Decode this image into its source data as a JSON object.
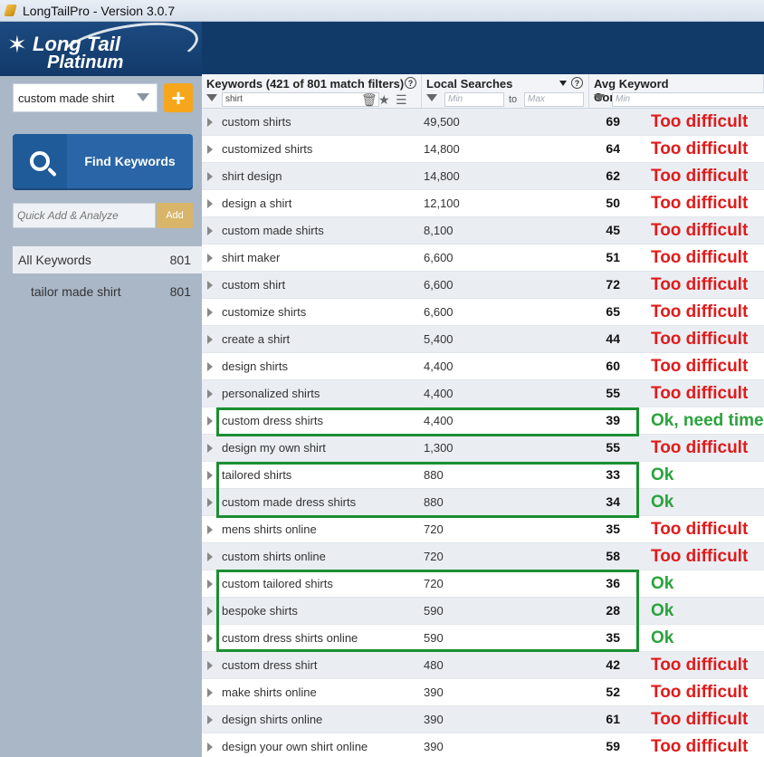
{
  "window": {
    "title": "LongTailPro - Version 3.0.7"
  },
  "brand": {
    "line1": "Long Tail",
    "line2": "Platinum"
  },
  "sidebar": {
    "seed_keyword": "custom made shirt",
    "add_label": "+",
    "find_label": "Find Keywords",
    "quick_add_placeholder": "Quick Add & Analyze",
    "quick_add_button": "Add",
    "items": [
      {
        "label": "All Keywords",
        "count": "801"
      },
      {
        "label": "tailor made shirt",
        "count": "801"
      }
    ]
  },
  "columns": {
    "keywords": {
      "title": "Keywords (421 of 801 match filters)",
      "filter_value": "shirt"
    },
    "local": {
      "title": "Local Searches",
      "min_placeholder": "Min",
      "to_label": "to",
      "max_placeholder": "Max"
    },
    "competitiveness": {
      "title": "Avg Keyword Competitiveness",
      "min_placeholder": "Min"
    }
  },
  "rows": [
    {
      "keyword": "custom shirts",
      "local": "49,500",
      "comp": "69",
      "note": "Too difficult",
      "status": "bad"
    },
    {
      "keyword": "customized shirts",
      "local": "14,800",
      "comp": "64",
      "note": "Too difficult",
      "status": "bad"
    },
    {
      "keyword": "shirt design",
      "local": "14,800",
      "comp": "62",
      "note": "Too difficult",
      "status": "bad"
    },
    {
      "keyword": "design a shirt",
      "local": "12,100",
      "comp": "50",
      "note": "Too difficult",
      "status": "bad"
    },
    {
      "keyword": "custom made shirts",
      "local": "8,100",
      "comp": "45",
      "note": "Too difficult",
      "status": "bad"
    },
    {
      "keyword": "shirt maker",
      "local": "6,600",
      "comp": "51",
      "note": "Too difficult",
      "status": "bad"
    },
    {
      "keyword": "custom shirt",
      "local": "6,600",
      "comp": "72",
      "note": "Too difficult",
      "status": "bad"
    },
    {
      "keyword": "customize shirts",
      "local": "6,600",
      "comp": "65",
      "note": "Too difficult",
      "status": "bad"
    },
    {
      "keyword": "create a shirt",
      "local": "5,400",
      "comp": "44",
      "note": "Too difficult",
      "status": "bad"
    },
    {
      "keyword": "design shirts",
      "local": "4,400",
      "comp": "60",
      "note": "Too difficult",
      "status": "bad"
    },
    {
      "keyword": "personalized shirts",
      "local": "4,400",
      "comp": "55",
      "note": "Too difficult",
      "status": "bad"
    },
    {
      "keyword": "custom dress shirts",
      "local": "4,400",
      "comp": "39",
      "note": "Ok, need time",
      "status": "good"
    },
    {
      "keyword": "design my own shirt",
      "local": "1,300",
      "comp": "55",
      "note": "Too difficult",
      "status": "bad"
    },
    {
      "keyword": "tailored shirts",
      "local": "880",
      "comp": "33",
      "note": "Ok",
      "status": "good"
    },
    {
      "keyword": "custom made dress shirts",
      "local": "880",
      "comp": "34",
      "note": "Ok",
      "status": "good"
    },
    {
      "keyword": "mens shirts online",
      "local": "720",
      "comp": "35",
      "note": "Too difficult",
      "status": "bad"
    },
    {
      "keyword": "custom shirts online",
      "local": "720",
      "comp": "58",
      "note": "Too difficult",
      "status": "bad"
    },
    {
      "keyword": "custom tailored shirts",
      "local": "720",
      "comp": "36",
      "note": "Ok",
      "status": "good"
    },
    {
      "keyword": "bespoke shirts",
      "local": "590",
      "comp": "28",
      "note": "Ok",
      "status": "good"
    },
    {
      "keyword": "custom dress shirts online",
      "local": "590",
      "comp": "35",
      "note": "Ok",
      "status": "good"
    },
    {
      "keyword": "custom dress shirt",
      "local": "480",
      "comp": "42",
      "note": "Too difficult",
      "status": "bad"
    },
    {
      "keyword": "make shirts online",
      "local": "390",
      "comp": "52",
      "note": "Too difficult",
      "status": "bad"
    },
    {
      "keyword": "design shirts online",
      "local": "390",
      "comp": "61",
      "note": "Too difficult",
      "status": "bad"
    },
    {
      "keyword": "design your own shirt online",
      "local": "390",
      "comp": "59",
      "note": "Too difficult",
      "status": "bad"
    }
  ],
  "colors": {
    "bad": "#e01b1b",
    "good": "#2aa33b",
    "highlight": "#1b8f32",
    "brand": "#123a69"
  }
}
